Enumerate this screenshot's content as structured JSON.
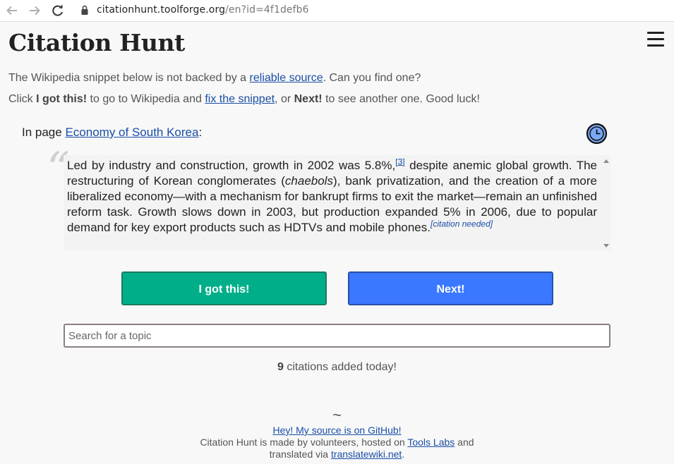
{
  "browser": {
    "url_host": "citationhunt.toolforge.org",
    "url_path": "/en?id=4f1defb6"
  },
  "header": {
    "title": "Citation Hunt"
  },
  "intro": {
    "line1_before": "The Wikipedia snippet below is not backed by a ",
    "line1_link": "reliable source",
    "line1_after": ". Can you find one?",
    "line2_a": "Click ",
    "line2_b": "I got this!",
    "line2_c": " to go to Wikipedia and ",
    "line2_link": "fix the snippet",
    "line2_d": ", or ",
    "line2_e": "Next!",
    "line2_f": " to see another one. Good luck!"
  },
  "card": {
    "in_page_prefix": "In page ",
    "page_link": "Economy of South Korea",
    "in_page_suffix": ":",
    "snippet": {
      "part1": "Led by industry and construction, growth in 2002 was 5.8%,",
      "ref": "[3]",
      "part2": " despite anemic global growth. The restructuring of Korean conglomerates (",
      "italic": "chaebols",
      "part3": "), bank privatization, and the creation of a more liberalized economy—with a mechanism for bankrupt firms to exit the market—remain an unfinished reform task. Growth slows down in 2003, but production expanded 5% in 2006, due to popular demand for key export products such as HDTVs and mobile phones.",
      "cn_open": "[",
      "cn_text": "citation needed",
      "cn_close": "]"
    }
  },
  "buttons": {
    "got_this": "I got this!",
    "next": "Next!"
  },
  "search": {
    "placeholder": "Search for a topic",
    "value": ""
  },
  "stats": {
    "count": "9",
    "suffix": " citations added today!"
  },
  "footer": {
    "tilde": "~",
    "github_link": "Hey! My source is on GitHub!",
    "line2_before": "Citation Hunt is made by volunteers, hosted on ",
    "tools_labs_link": "Tools Labs",
    "line2_after": " and",
    "line3_before": "translated via ",
    "translatewiki_link": "translatewiki.net",
    "line3_after": "."
  },
  "icons": {
    "back": "arrow-left-icon",
    "forward": "arrow-right-icon",
    "reload": "reload-icon",
    "lock": "lock-icon",
    "menu": "hamburger-menu-icon",
    "clock": "clock-icon"
  },
  "colors": {
    "got_this_button": "#00af89",
    "next_button": "#3a78ff",
    "link": "#1a4ea6",
    "clock_fill": "#7aa8f5"
  }
}
